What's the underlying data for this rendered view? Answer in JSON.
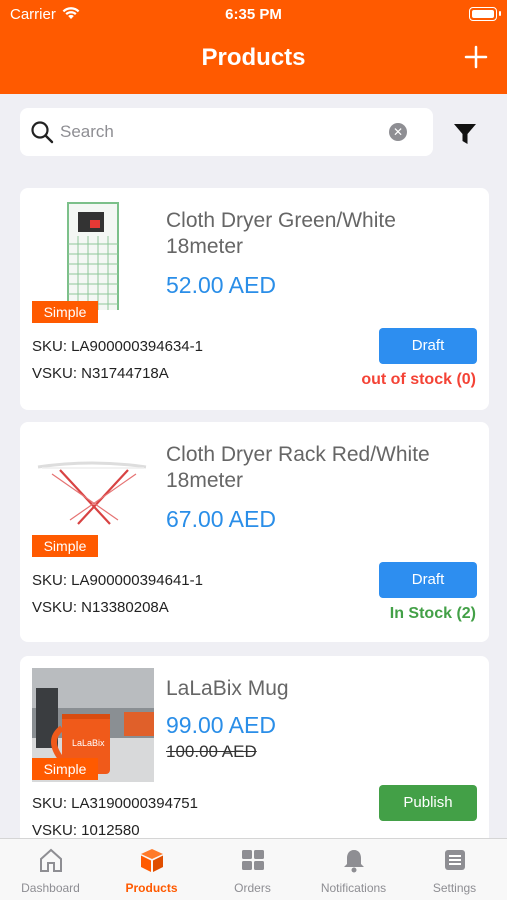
{
  "status_bar": {
    "carrier": "Carrier",
    "time": "6:35 PM"
  },
  "header": {
    "title": "Products",
    "add_icon": "plus-icon"
  },
  "search": {
    "placeholder": "Search",
    "value": "",
    "search_icon": "magnifier-icon",
    "clear_icon": "clear-circle-icon",
    "filter_icon": "funnel-icon"
  },
  "products": [
    {
      "name": "Cloth Dryer Green/White 18meter",
      "price": "52.00 AED",
      "old_price": "",
      "type": "Simple",
      "sku": "SKU: LA900000394634-1",
      "vsku": "VSKU: N31744718A",
      "action": "Draft",
      "action_color": "#2d8ef0",
      "stock": "out of stock (0)",
      "stock_color": "#f44336",
      "image": "cloth-dryer-green-white"
    },
    {
      "name": "Cloth Dryer Rack Red/White 18meter",
      "price": "67.00 AED",
      "old_price": "",
      "type": "Simple",
      "sku": "SKU: LA900000394641-1",
      "vsku": "VSKU: N13380208A",
      "action": "Draft",
      "action_color": "#2d8ef0",
      "stock": "In Stock (2)",
      "stock_color": "#43a047",
      "image": "cloth-dryer-rack-red-white"
    },
    {
      "name": "LaLaBix Mug",
      "price": "99.00 AED",
      "old_price": "100.00 AED",
      "type": "Simple",
      "sku": "SKU: LA3190000394751",
      "vsku": "VSKU: 1012580",
      "action": "Publish",
      "action_color": "#43a047",
      "stock": "",
      "stock_color": "#43a047",
      "image": "lalabix-orange-mug",
      "mug_print": "LaLaBix"
    }
  ],
  "tabs": [
    {
      "label": "Dashboard",
      "icon": "home-icon",
      "active": false
    },
    {
      "label": "Products",
      "icon": "box-icon",
      "active": true
    },
    {
      "label": "Orders",
      "icon": "grid-icon",
      "active": false
    },
    {
      "label": "Notifications",
      "icon": "bell-icon",
      "active": false
    },
    {
      "label": "Settings",
      "icon": "list-icon",
      "active": false
    }
  ],
  "colors": {
    "brand": "#ff5a00",
    "price": "#2a8ee8",
    "background": "#efeff4",
    "tab_inactive": "#8e8e93"
  }
}
